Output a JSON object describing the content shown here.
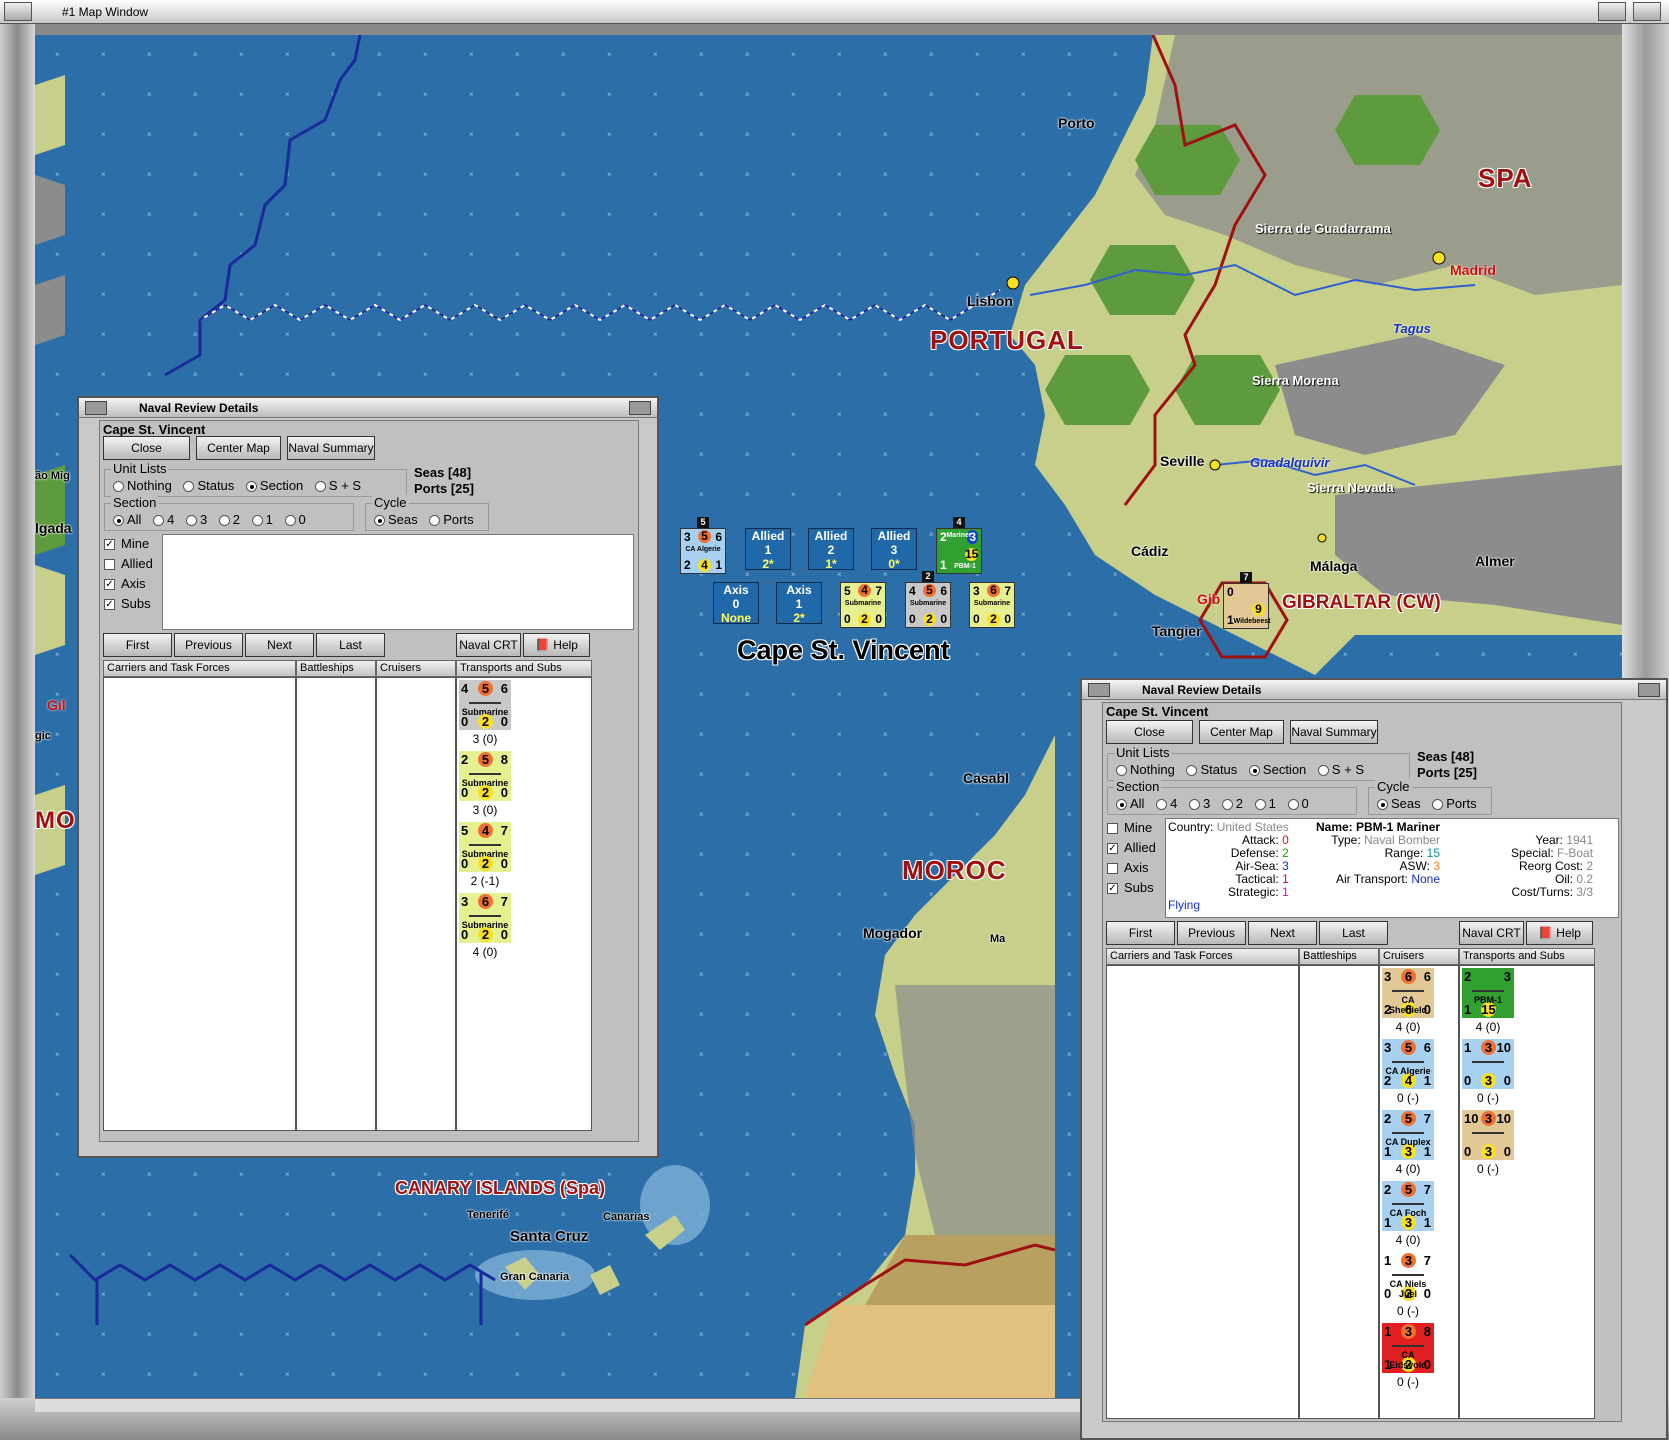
{
  "window": {
    "title": "#1 Map Window"
  },
  "map": {
    "cities": [
      "Porto",
      "Lisbon",
      "Madrid",
      "Seville",
      "Cádiz",
      "Málaga",
      "Tangier",
      "Casabl",
      "Mogador",
      "Santa Cruz",
      "Tenerifé",
      "Canarias",
      "Gran Canaria",
      "Almer",
      "Gib",
      "Ma",
      "Gil",
      "ão Mig",
      "lgada",
      "gic"
    ],
    "rivers": [
      "Tagus",
      "Guadalquivir"
    ],
    "mountains": [
      "Sierra de Guadarrama",
      "Sierra Morena",
      "Sierra Nevada"
    ],
    "countries": [
      "PORTUGAL",
      "SPA",
      "MOROC",
      "GIBRALTAR (CW)",
      "CANARY ISLANDS (Spa)",
      "MO"
    ],
    "sea_name": "Cape St. Vincent",
    "summary_allied": [
      {
        "label": "Allied",
        "n": "1",
        "v": "2*"
      },
      {
        "label": "Allied",
        "n": "2",
        "v": "1*"
      },
      {
        "label": "Allied",
        "n": "3",
        "v": "0*"
      }
    ],
    "summary_axis": [
      {
        "label": "Axis",
        "n": "0",
        "v": "None"
      },
      {
        "label": "Axis",
        "n": "1",
        "v": "2*"
      }
    ],
    "ca_algerie": {
      "tl": "3",
      "tm": "5",
      "tr": "6",
      "bl": "2",
      "bm": "4",
      "br": "1",
      "name": "CA Algerie",
      "stack": "5"
    },
    "mariner": {
      "name": "Mariner",
      "sub": "PBM-1",
      "stack": "4",
      "tl": "2",
      "tr": "3",
      "bm": "15",
      "bl": "1"
    },
    "subs_map": [
      {
        "tl": "5",
        "tm": "4",
        "tr": "7",
        "bl": "0",
        "bm": "2",
        "br": "0",
        "name": "Submarine",
        "color": "#e6f090"
      },
      {
        "tl": "4",
        "tm": "5",
        "tr": "6",
        "bl": "0",
        "bm": "2",
        "br": "0",
        "name": "Submarine",
        "color": "#c8c8c8",
        "stack": "2"
      },
      {
        "tl": "3",
        "tm": "6",
        "tr": "7",
        "bl": "0",
        "bm": "2",
        "br": "0",
        "name": "Submarine",
        "color": "#e6f090"
      }
    ],
    "gibraltar_unit": {
      "name": "Wildebeest",
      "tl": "0",
      "bm": "9",
      "bl": "1",
      "stack": "7"
    }
  },
  "dialog1": {
    "title": "Naval Review Details",
    "location": "Cape St. Vincent",
    "buttons": {
      "close": "Close",
      "center": "Center Map",
      "summary": "Naval Summary"
    },
    "seas": "Seas [48]",
    "ports": "Ports [25]",
    "unit_lists_label": "Unit Lists",
    "unit_lists": [
      "Nothing",
      "Status",
      "Section",
      "S + S"
    ],
    "section_label": "Section",
    "sections": [
      "All",
      "4",
      "3",
      "2",
      "1",
      "0"
    ],
    "cycle_label": "Cycle",
    "cycle": [
      "Seas",
      "Ports"
    ],
    "checks": [
      "Mine",
      "Allied",
      "Axis",
      "Subs"
    ],
    "nav": {
      "first": "First",
      "previous": "Previous",
      "next": "Next",
      "last": "Last",
      "crt": "Naval CRT",
      "help": "Help"
    },
    "columns": [
      "Carriers and Task Forces",
      "Battleships",
      "Cruisers",
      "Transports and Subs"
    ],
    "subs": [
      {
        "tl": "4",
        "tm": "5",
        "tr": "6",
        "bl": "0",
        "bm": "2",
        "br": "0",
        "name": "Submarine",
        "val": "3 (0)",
        "color": "#c8c8c8"
      },
      {
        "tl": "2",
        "tm": "5",
        "tr": "8",
        "bl": "0",
        "bm": "2",
        "br": "0",
        "name": "Submarine",
        "val": "3 (0)",
        "color": "#e6f090"
      },
      {
        "tl": "5",
        "tm": "4",
        "tr": "7",
        "bl": "0",
        "bm": "2",
        "br": "0",
        "name": "Submarine",
        "val": "2 (-1)",
        "color": "#e6f090"
      },
      {
        "tl": "3",
        "tm": "6",
        "tr": "7",
        "bl": "0",
        "bm": "2",
        "br": "0",
        "name": "Submarine",
        "val": "4 (0)",
        "color": "#e6f090"
      }
    ]
  },
  "dialog2": {
    "title": "Naval Review Details",
    "location": "Cape St. Vincent",
    "buttons": {
      "close": "Close",
      "center": "Center Map",
      "summary": "Naval Summary"
    },
    "seas": "Seas [48]",
    "ports": "Ports [25]",
    "unit_lists_label": "Unit Lists",
    "unit_lists": [
      "Nothing",
      "Status",
      "Section",
      "S + S"
    ],
    "section_label": "Section",
    "sections": [
      "All",
      "4",
      "3",
      "2",
      "1",
      "0"
    ],
    "cycle_label": "Cycle",
    "cycle": [
      "Seas",
      "Ports"
    ],
    "checks": [
      "Mine",
      "Allied",
      "Axis",
      "Subs"
    ],
    "info_left": [
      {
        "k": "Country:",
        "v": "United States",
        "c": "#888888"
      },
      {
        "k": "Attack:",
        "v": "0",
        "c": "#d01010"
      },
      {
        "k": "Defense:",
        "v": "2",
        "c": "#10a010"
      },
      {
        "k": "Air-Sea:",
        "v": "3",
        "c": "#1030c0"
      },
      {
        "k": "Tactical:",
        "v": "1",
        "c": "#c01010"
      },
      {
        "k": "Strategic:",
        "v": "1",
        "c": "#c010c0"
      }
    ],
    "flying": "Flying",
    "info_name": "Name: PBM-1 Mariner",
    "info_mid": [
      {
        "k": "Type:",
        "v": "Naval Bomber",
        "c": "#888888"
      },
      {
        "k": "Range:",
        "v": "15",
        "c": "#1090a0"
      },
      {
        "k": "ASW:",
        "v": "3",
        "c": "#f08020"
      },
      {
        "k": "Air Transport:",
        "v": "None",
        "c": "#1030c0"
      }
    ],
    "info_right": [
      {
        "k": "Year:",
        "v": "1941",
        "c": "#888888"
      },
      {
        "k": "Special:",
        "v": "F-Boat",
        "c": "#888888"
      },
      {
        "k": "Reorg Cost:",
        "v": "2",
        "c": "#888888"
      },
      {
        "k": "Oil:",
        "v": "0.2",
        "c": "#888888"
      },
      {
        "k": "Cost/Turns:",
        "v": "3/3",
        "c": "#888888"
      }
    ],
    "nav": {
      "first": "First",
      "previous": "Previous",
      "next": "Next",
      "last": "Last",
      "crt": "Naval CRT",
      "help": "Help"
    },
    "columns": [
      "Carriers and Task Forces",
      "Battleships",
      "Cruisers",
      "Transports and Subs"
    ],
    "cruisers": [
      {
        "tl": "3",
        "tm": "6",
        "tr": "6",
        "bl": "2",
        "bm": "6",
        "br": "0",
        "name": "CA Sheffield",
        "val": "4 (0)",
        "color": "#e2c896"
      },
      {
        "tl": "3",
        "tm": "5",
        "tr": "6",
        "bl": "2",
        "bm": "4",
        "br": "1",
        "name": "CA Algerie",
        "val": "0 (-)",
        "color": "#a8d0f0"
      },
      {
        "tl": "2",
        "tm": "5",
        "tr": "7",
        "bl": "1",
        "bm": "3",
        "br": "1",
        "name": "CA Duplex",
        "val": "4 (0)",
        "color": "#a8d0f0"
      },
      {
        "tl": "2",
        "tm": "5",
        "tr": "7",
        "bl": "1",
        "bm": "3",
        "br": "1",
        "name": "CA Foch",
        "val": "4 (0)",
        "color": "#a8d0f0"
      },
      {
        "tl": "1",
        "tm": "3",
        "tr": "7",
        "bl": "0",
        "bm": "2",
        "br": "0",
        "name": "CA Niels Juel",
        "val": "0 (-)",
        "color": "#ffffff"
      },
      {
        "tl": "1",
        "tm": "3",
        "tr": "8",
        "bl": "1",
        "bm": "2",
        "br": "0",
        "name": "CA Eidsvold",
        "val": "0 (-)",
        "color": "#e02020"
      }
    ],
    "transports": [
      {
        "tl": "2",
        "tm": "",
        "tr": "3",
        "bl": "1",
        "bm": "15",
        "br": "",
        "name": "PBM-1",
        "val": "4 (0)",
        "color": "#30a030"
      },
      {
        "tl": "1",
        "tm": "3",
        "tr": "10",
        "bl": "0",
        "bm": "3",
        "br": "0",
        "name": "",
        "val": "0 (-)",
        "color": "#a8d0f0"
      },
      {
        "tl": "10",
        "tm": "3",
        "tr": "10",
        "bl": "0",
        "bm": "3",
        "br": "0",
        "name": "",
        "val": "0 (-)",
        "color": "#e2c896"
      }
    ]
  },
  "colors": {
    "sea": "#2c6ea8",
    "land": "#c7cf8a",
    "forest": "#5e9a3e",
    "mountain": "#8c8c8c",
    "border": "#a01010",
    "convoy": "#1a2a9a"
  }
}
